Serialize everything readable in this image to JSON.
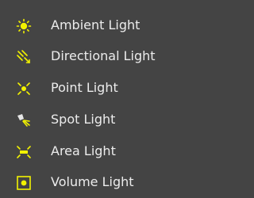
{
  "menu": {
    "items": [
      {
        "label": "Ambient Light",
        "icon": "ambient-light-icon"
      },
      {
        "label": "Directional Light",
        "icon": "directional-light-icon"
      },
      {
        "label": "Point Light",
        "icon": "point-light-icon"
      },
      {
        "label": "Spot Light",
        "icon": "spot-light-icon"
      },
      {
        "label": "Area Light",
        "icon": "area-light-icon"
      },
      {
        "label": "Volume Light",
        "icon": "volume-light-icon"
      }
    ]
  },
  "colors": {
    "background": "#444444",
    "text": "#ececec",
    "icon_yellow": "#f2f200"
  }
}
